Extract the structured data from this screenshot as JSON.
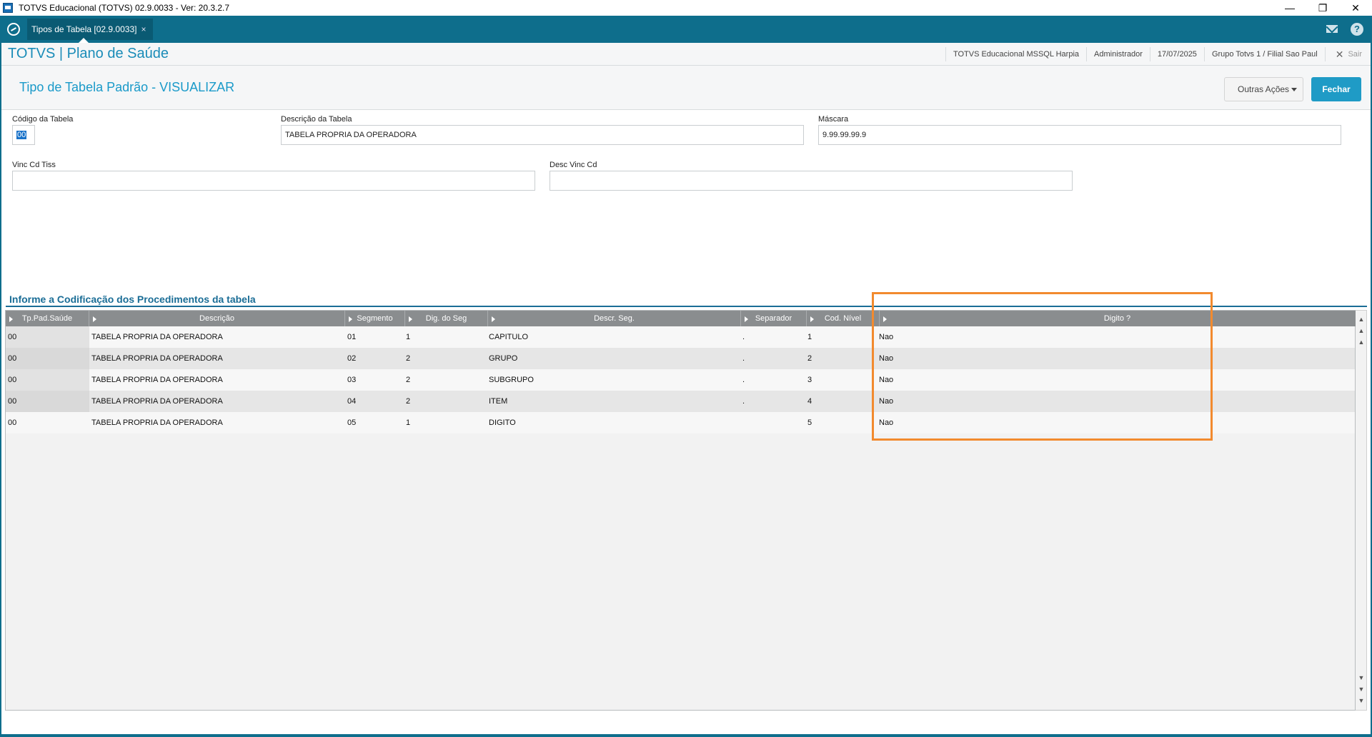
{
  "window": {
    "title": "TOTVS Educacional (TOTVS) 02.9.0033 - Ver: 20.3.2.7"
  },
  "tabs": [
    {
      "label": "Tipos de Tabela [02.9.0033]"
    }
  ],
  "header": {
    "brand": "TOTVS | Plano de Saúde",
    "environment": "TOTVS Educacional MSSQL Harpia",
    "user": "Administrador",
    "date": "17/07/2025",
    "branch": "Grupo Totvs 1 / Filial Sao Paul",
    "exit_label": "Sair"
  },
  "page": {
    "title": "Tipo de Tabela Padrão - VISUALIZAR",
    "other_actions_label": "Outras Ações",
    "close_label": "Fechar"
  },
  "form": {
    "codigo": {
      "label": "Código da Tabela",
      "value": "00"
    },
    "descricao": {
      "label": "Descrição da Tabela",
      "value": "TABELA PROPRIA DA OPERADORA"
    },
    "mascara": {
      "label": "Máscara",
      "value": "9.99.99.99.9"
    },
    "vinc_cd_tiss": {
      "label": "Vinc Cd Tiss",
      "value": ""
    },
    "desc_vinc_cd": {
      "label": "Desc Vinc Cd",
      "value": ""
    }
  },
  "section": {
    "title": "Informe a Codificação dos Procedimentos da tabela"
  },
  "grid": {
    "columns": [
      "Tp.Pad.Saúde",
      "Descrição",
      "Segmento",
      "Dig. do Seg",
      "Descr. Seg.",
      "Separador",
      "Cod. Nível",
      "Digito ?"
    ],
    "rows": [
      [
        "00",
        "TABELA PROPRIA DA OPERADORA",
        "01",
        "1",
        "CAPITULO",
        ".",
        "1",
        "Nao"
      ],
      [
        "00",
        "TABELA PROPRIA DA OPERADORA",
        "02",
        "2",
        "GRUPO",
        ".",
        "2",
        "Nao"
      ],
      [
        "00",
        "TABELA PROPRIA DA OPERADORA",
        "03",
        "2",
        "SUBGRUPO",
        ".",
        "3",
        "Nao"
      ],
      [
        "00",
        "TABELA PROPRIA DA OPERADORA",
        "04",
        "2",
        "ITEM",
        ".",
        "4",
        "Nao"
      ],
      [
        "00",
        "TABELA PROPRIA DA OPERADORA",
        "05",
        "1",
        "DIGITO",
        "",
        "5",
        "Nao"
      ]
    ]
  },
  "colors": {
    "accent": "#0e6e8c",
    "title_blue": "#1a9ac9",
    "highlight": "#f28a2e",
    "button_primary": "#1f9bc6"
  }
}
